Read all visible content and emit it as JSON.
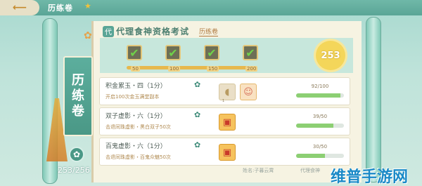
{
  "topbar": {
    "back_icon": "arrow-left-icon",
    "title": "历练卷",
    "star_icon": "star-icon"
  },
  "left": {
    "vertical_title": [
      "历",
      "练",
      "卷"
    ],
    "score": "253/256",
    "badge_icon": "flower-icon"
  },
  "exam": {
    "title": "代理食神资格考试",
    "sublink": "历练卷",
    "milestones": [
      {
        "label": "50",
        "done": true
      },
      {
        "label": "100",
        "done": true
      },
      {
        "label": "150",
        "done": true
      },
      {
        "label": "200",
        "done": true
      }
    ],
    "total_score": "253"
  },
  "tasks": [
    {
      "name": "积金累玉・四（1分）",
      "desc": "开启100次金玉满堂副本",
      "rewards": [
        "dumpling-icon",
        "avatar-icon"
      ],
      "reward_count": "1",
      "progress_text": "92/100",
      "progress": 0.92
    },
    {
      "name": "双子虚影・六（1分）",
      "desc": "击退同珠虚影・黑白双子50次",
      "rewards": [
        "red-box-icon"
      ],
      "progress_text": "39/50",
      "progress": 0.78
    },
    {
      "name": "百鬼虚影・六（1分）",
      "desc": "击退同珠虚影・百鬼众魅50次",
      "rewards": [
        "red-box-icon"
      ],
      "progress_text": "30/50",
      "progress": 0.6
    }
  ],
  "footer": {
    "name": "姓名:子暮云霄",
    "code": "代理食神"
  },
  "watermark": "维普手游网"
}
